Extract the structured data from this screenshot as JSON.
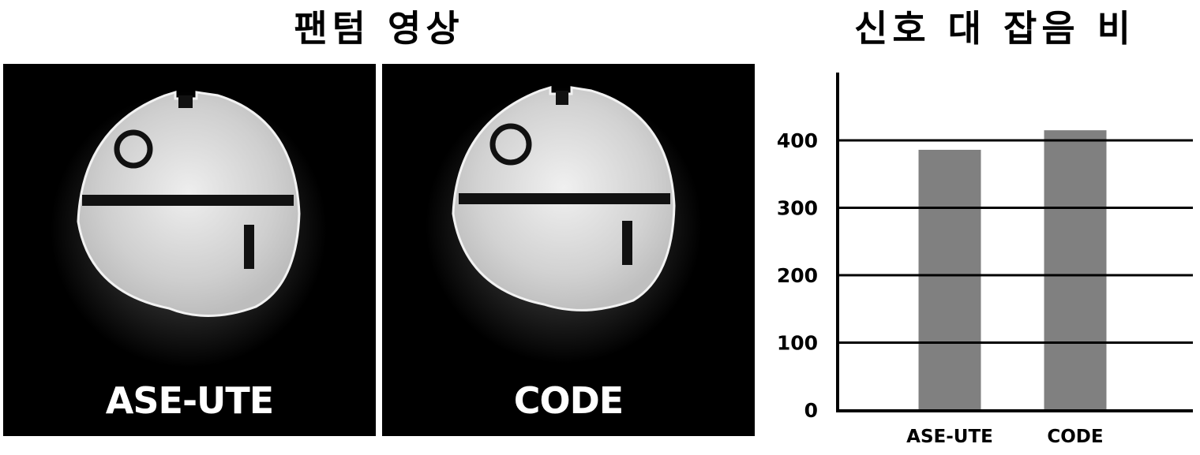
{
  "titles": {
    "left": "팬텀 영상",
    "right": "신호 대 잡음 비"
  },
  "panels": [
    {
      "label": "ASE-UTE",
      "image": "phantom-mri-image"
    },
    {
      "label": "CODE",
      "image": "phantom-mri-image"
    }
  ],
  "chart_data": {
    "type": "bar",
    "title": "신호 대 잡음 비",
    "categories": [
      "ASE-UTE",
      "CODE"
    ],
    "values": [
      386,
      415
    ],
    "xlabel": "",
    "ylabel": "",
    "ylim": [
      0,
      480
    ],
    "yticks": [
      0,
      100,
      200,
      300,
      400
    ],
    "ytick_labels": [
      "0",
      "100",
      "200",
      "300",
      "400"
    ],
    "grid": true,
    "bar_color": "#808080",
    "legend": "none"
  }
}
